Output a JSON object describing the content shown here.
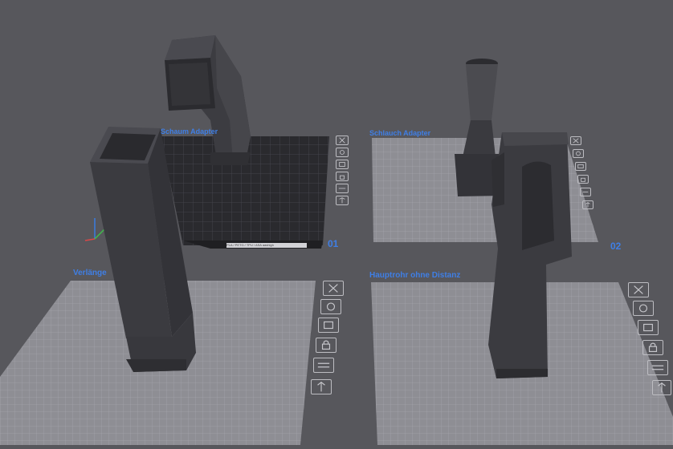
{
  "plates": [
    {
      "id": "plate-1",
      "name": "Schaum Adapter",
      "number": "01",
      "active": true
    },
    {
      "id": "plate-2",
      "name": "Schlauch Adapter",
      "number": "02",
      "active": false
    },
    {
      "id": "plate-3",
      "name": "Verlänge",
      "number": "",
      "active": false
    },
    {
      "id": "plate-4",
      "name": "Hauptrohr ohne Distanz",
      "number": "",
      "active": false
    }
  ],
  "plate_tools": [
    "close-icon",
    "auto-orient-icon",
    "arrange-icon",
    "lock-icon",
    "settings-icon",
    "move-icon"
  ],
  "bed_brand_text": "PLA / PETG / TPU / ASA    aashigh",
  "colors": {
    "background": "#57575c",
    "plate": "#8e8e94",
    "grid": "#a5a5ab",
    "label": "#3f7fe6",
    "model": "#3c3c41",
    "bed": "#2a2a2e"
  }
}
